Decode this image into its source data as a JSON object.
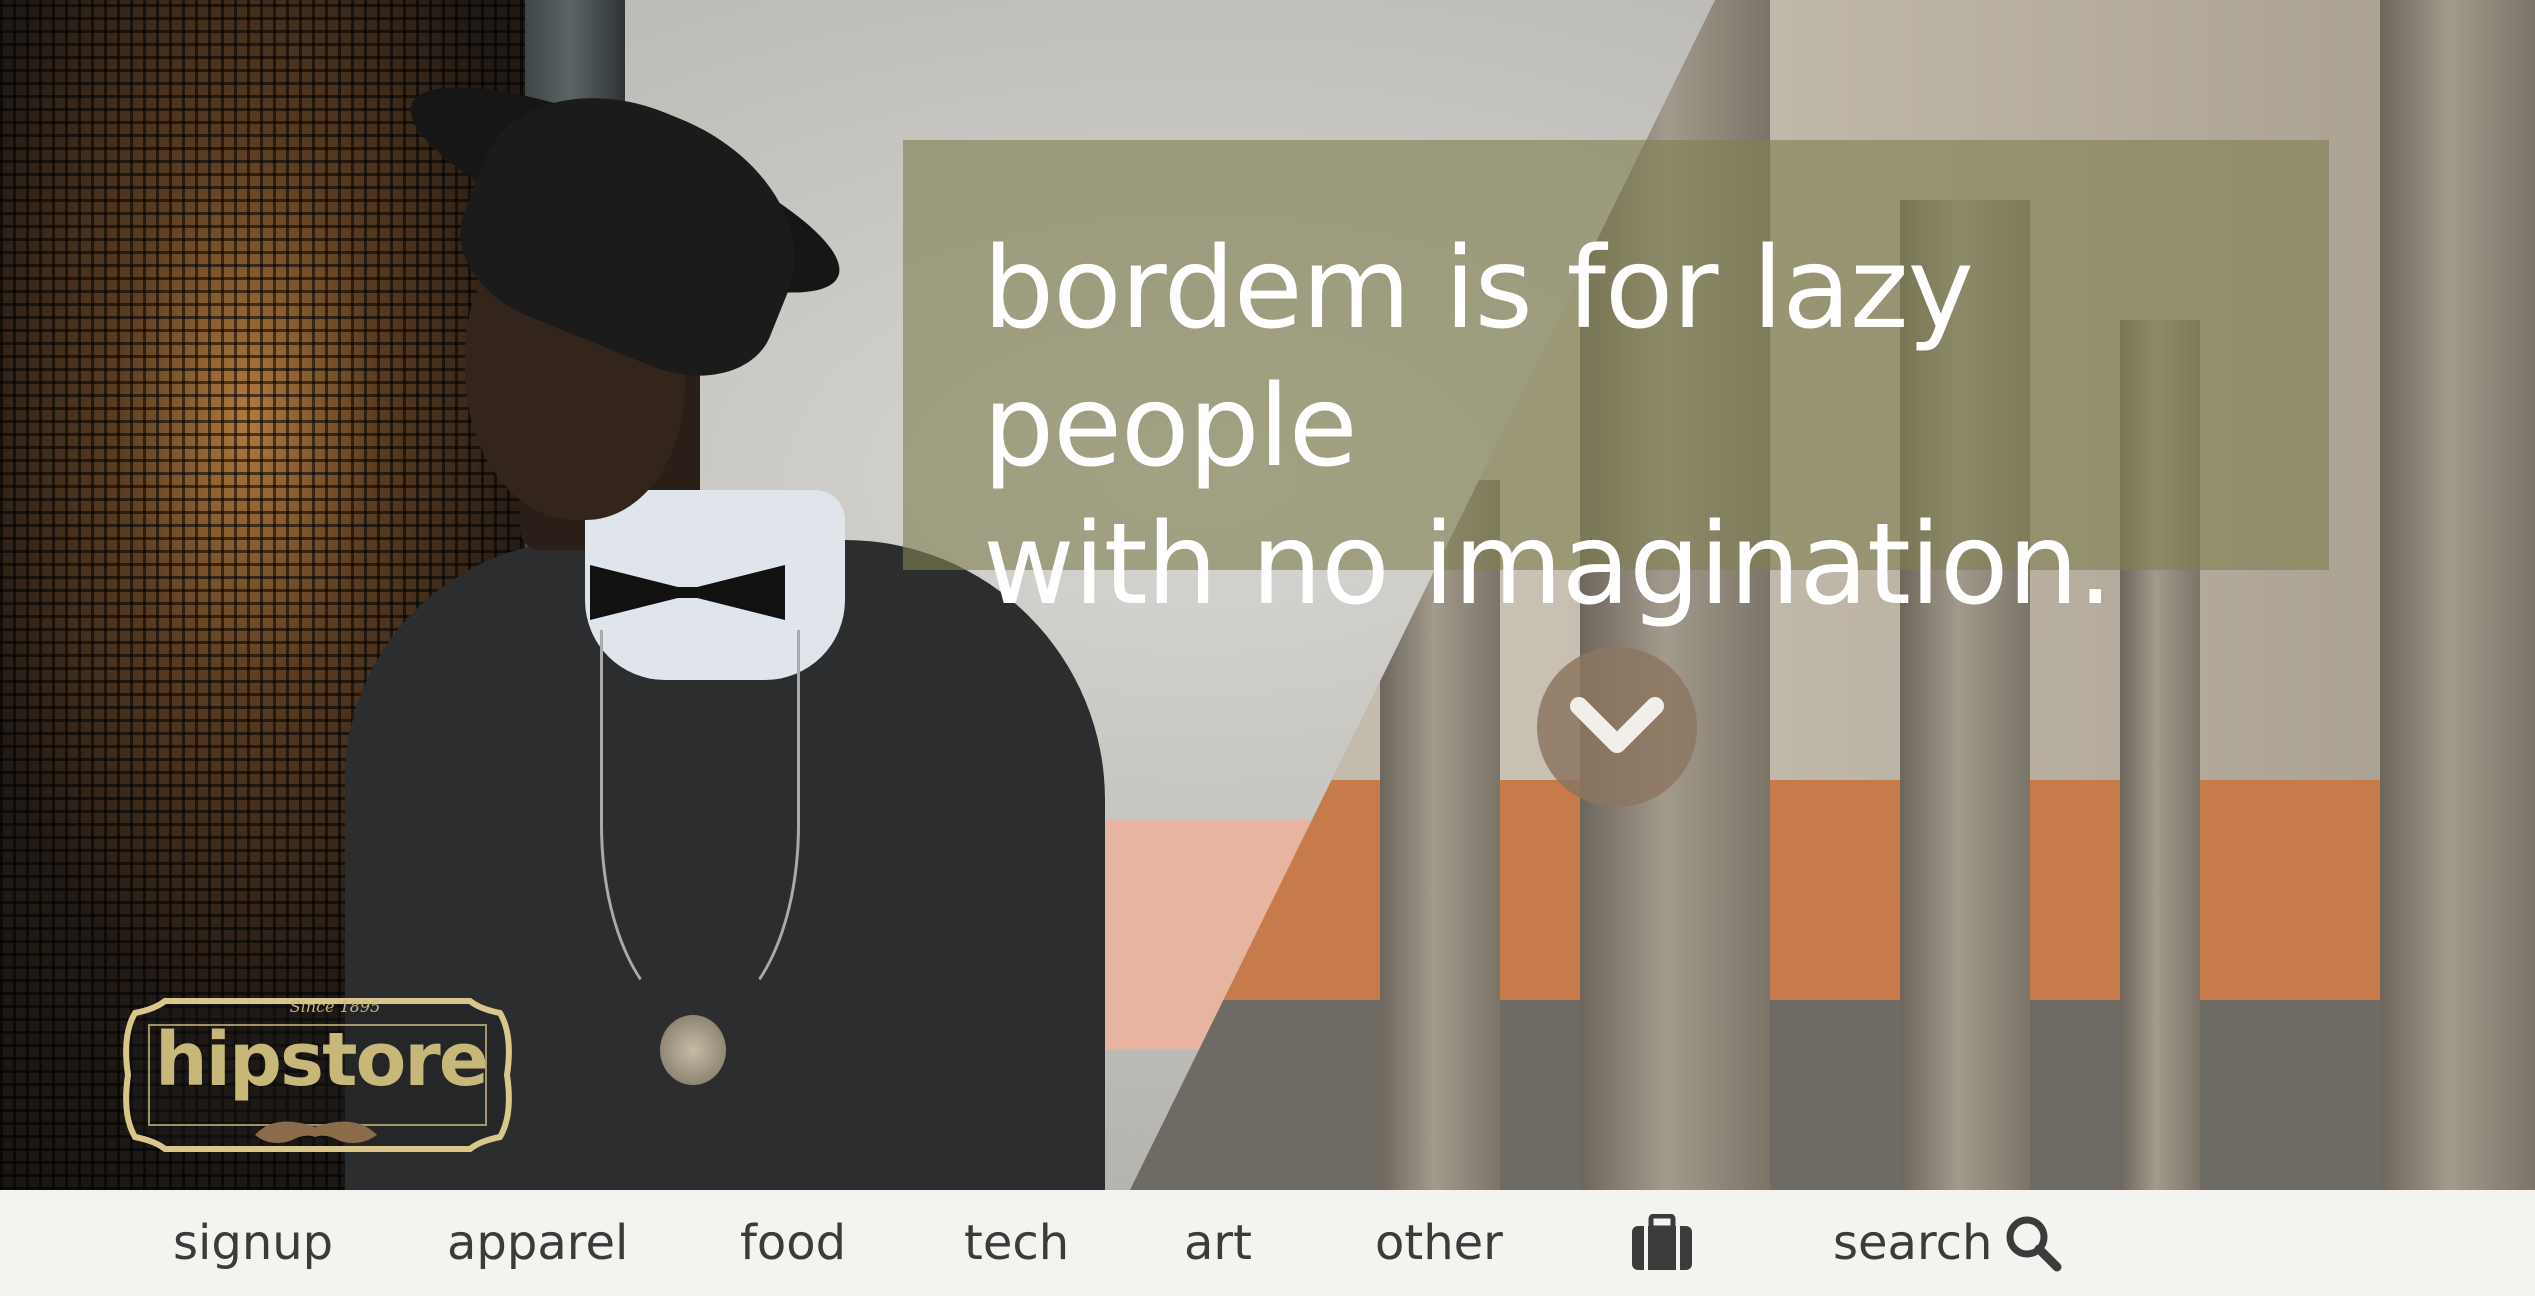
{
  "hero": {
    "quote_line_1": "bordem is for lazy people",
    "quote_line_2": "with no imagination.",
    "scroll_icon": "chevron-down-icon",
    "overlay_color": "#80805299"
  },
  "logo": {
    "text": "hipstore",
    "tagline": "Since 1895",
    "icon": "mustache-icon",
    "color": "#c7b87a"
  },
  "nav": {
    "items": [
      {
        "label": "signup"
      },
      {
        "label": "apparel"
      },
      {
        "label": "food"
      },
      {
        "label": "tech"
      },
      {
        "label": "art"
      },
      {
        "label": "other"
      }
    ],
    "cart_icon": "briefcase-icon",
    "search_label": "search",
    "search_icon": "search-icon",
    "background": "#f3f3ef",
    "text_color": "#3b3b3b"
  }
}
